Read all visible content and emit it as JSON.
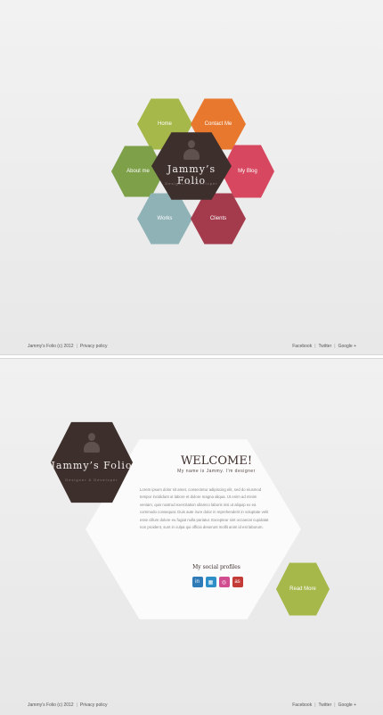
{
  "brand": {
    "title": "Jammy’s Folio",
    "subtitle": "Designer & Developer"
  },
  "nav": [
    {
      "label": "Home",
      "color": "#a5b849"
    },
    {
      "label": "Contact Me",
      "color": "#e8782d"
    },
    {
      "label": "About me",
      "color": "#7da048"
    },
    {
      "label": "My Blog",
      "color": "#d7475f"
    },
    {
      "label": "Works",
      "color": "#8fb2b7"
    },
    {
      "label": "Clients",
      "color": "#a43b4d"
    }
  ],
  "footer": {
    "copyright": "Jammy’s Folio (c) 2012",
    "privacy": "Privacy policy",
    "links": [
      "Facebook",
      "Twitter",
      "Google +"
    ]
  },
  "about": {
    "welcome": "WELCOME!",
    "intro": "My name is Jammy. I’m designer",
    "body": "Lorem ipsum dolor sit amet, consectetur adipiscing elit, sed do eiusmod tempor incididunt ut labore et dolore magna aliqua. Ut enim ad minim veniam, quis nostrud exercitation ullamco laboris nisi ut aliquip ex ea commodo consequat. Duis aute irure dolor in reprehenderit in voluptate velit esse cillum dolore eu fugiat nulla pariatur. Excepteur sint occaecat cupidatat non proident, sunt in culpa qui officia deserunt mollit anim id est laborum.",
    "social_title": "My social profiles",
    "social": [
      {
        "icon": "linkedin-icon",
        "glyph": "in",
        "color": "#2f7bb8"
      },
      {
        "icon": "delicious-icon",
        "glyph": "▦",
        "color": "#2f90c8"
      },
      {
        "icon": "dribbble-icon",
        "glyph": "◎",
        "color": "#d04e90"
      },
      {
        "icon": "lastfm-icon",
        "glyph": "as",
        "color": "#c33a37"
      }
    ],
    "read_more": "Read More"
  }
}
